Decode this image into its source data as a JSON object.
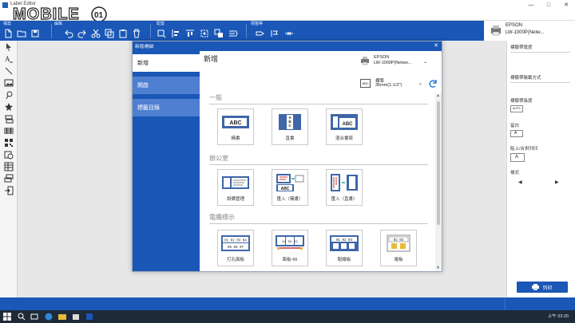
{
  "window": {
    "title": "Label Editor",
    "watermark": "MOBILE01",
    "controls": [
      "—",
      "□",
      "✕"
    ]
  },
  "ribbon": {
    "groups": [
      {
        "label": "檔案",
        "icons": [
          "new-file-icon",
          "open-folder-icon",
          "save-icon"
        ]
      },
      {
        "label": "編輯",
        "icons": [
          "undo-icon",
          "redo-icon",
          "cut-icon",
          "copy-icon",
          "paste-icon",
          "delete-icon"
        ]
      },
      {
        "label": "配置",
        "icons": [
          "align-left-icon",
          "align-center-icon",
          "align-right-icon",
          "distribute-icon",
          "arrange-icon",
          "group-icon"
        ]
      },
      {
        "label": "標籤等",
        "icons": [
          "label-arrow-icon",
          "label-flag-icon",
          "label-fit-icon"
        ]
      }
    ],
    "printer": {
      "name": "EPSON",
      "model": "LW-1000P(Netw..."
    }
  },
  "left_tools": [
    "pointer-icon",
    "text-icon",
    "line-icon",
    "image-icon",
    "clipart-icon",
    "symbol-icon",
    "frame-icon",
    "barcode-icon",
    "qrcode-icon",
    "datetime-icon",
    "table-icon",
    "layout-icon",
    "import-icon"
  ],
  "right_panel": {
    "items": [
      {
        "label": "標籤帶寬度"
      },
      {
        "label": "標籤帶裝載方式"
      },
      {
        "label": "標籤帶長度"
      },
      {
        "label": "留白"
      },
      {
        "label": "貼上/合併列印"
      },
      {
        "label": "樣式"
      }
    ],
    "field_texts": [
      "AUTO",
      "A",
      "A"
    ],
    "print_button": "列印"
  },
  "dialog": {
    "title": "新增/開啟",
    "close": "✕",
    "sidebar": [
      {
        "label": "新增"
      },
      {
        "label": "開啟"
      },
      {
        "label": "標籤目錄"
      }
    ],
    "main_title": "新增",
    "printer": {
      "name": "EPSON",
      "model": "LW-1000P(Netwo..."
    },
    "tape": {
      "name": "標準",
      "size": "36mm(1-1/2\")",
      "icon_text": "ABC"
    },
    "sections": [
      {
        "title": "一般",
        "tiles": [
          {
            "label": "橫書",
            "art_text": "ABC"
          },
          {
            "label": "直書",
            "art_text": "ABC"
          },
          {
            "label": "混合書寫",
            "art_text": "ABC"
          }
        ]
      },
      {
        "title": "辦公室",
        "tiles": [
          {
            "label": "設備管理",
            "art_text": ""
          },
          {
            "label": "匯入（橫書）",
            "art_text": "ABC"
          },
          {
            "label": "匯入（直書）",
            "art_text": ""
          }
        ]
      },
      {
        "title": "電纜標示",
        "tiles": [
          {
            "label": "打孔面板",
            "art_text": "01 02 03 04 05 06 07"
          },
          {
            "label": "面板-66",
            "art_text": "01 02 03"
          },
          {
            "label": "配線板",
            "art_text": "01 02 03"
          },
          {
            "label": "電板",
            "art_text": "02 03"
          }
        ]
      }
    ]
  },
  "taskbar": {
    "time": "上午 03:20"
  },
  "colors": {
    "ribbon": "#1a57b6",
    "sidebar_inactive": "#4f7fd0",
    "dialog_bg": "#ffffff"
  }
}
